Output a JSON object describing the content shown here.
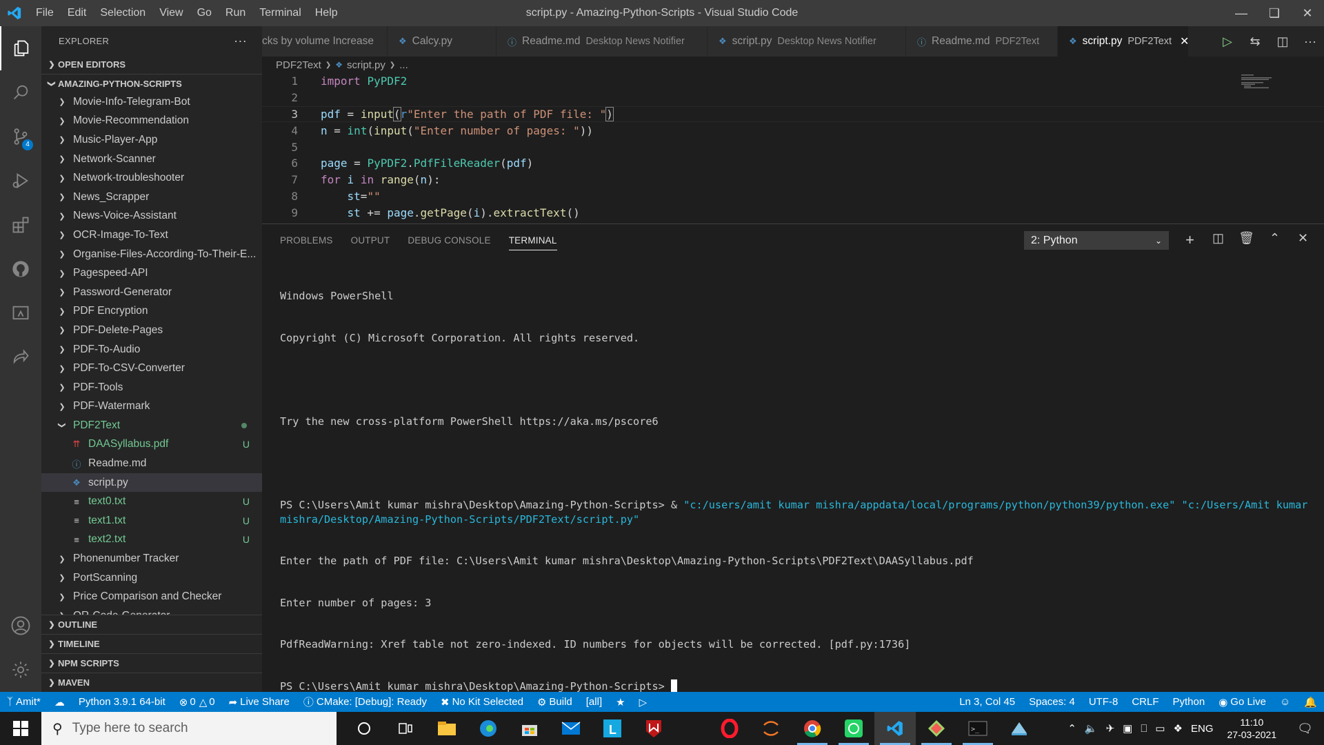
{
  "window": {
    "title": "script.py - Amazing-Python-Scripts - Visual Studio Code",
    "menu": [
      "File",
      "Edit",
      "Selection",
      "View",
      "Go",
      "Run",
      "Terminal",
      "Help"
    ]
  },
  "activity_bar": {
    "items": [
      "explorer-icon",
      "search-icon",
      "source-control-icon",
      "run-debug-icon",
      "extensions-icon",
      "github-icon",
      "remote-explorer-icon",
      "live-share-icon"
    ],
    "source_control_badge": "4",
    "bottom": [
      "account-icon",
      "settings-gear-icon"
    ]
  },
  "sidebar": {
    "title": "EXPLORER",
    "open_editors": "OPEN EDITORS",
    "workspace": "AMAZING-PYTHON-SCRIPTS",
    "folders": [
      "Movie-Info-Telegram-Bot",
      "Movie-Recommendation",
      "Music-Player-App",
      "Network-Scanner",
      "Network-troubleshooter",
      "News_Scrapper",
      "News-Voice-Assistant",
      "OCR-Image-To-Text",
      "Organise-Files-According-To-Their-E...",
      "Pagespeed-API",
      "Password-Generator",
      "PDF Encryption",
      "PDF-Delete-Pages",
      "PDF-To-Audio",
      "PDF-To-CSV-Converter",
      "PDF-Tools",
      "PDF-Watermark"
    ],
    "open_folder": "PDF2Text",
    "files": [
      {
        "name": "DAASyllabus.pdf",
        "status": "U"
      },
      {
        "name": "Readme.md",
        "status": ""
      },
      {
        "name": "script.py",
        "status": ""
      },
      {
        "name": "text0.txt",
        "status": "U"
      },
      {
        "name": "text1.txt",
        "status": "U"
      },
      {
        "name": "text2.txt",
        "status": "U"
      }
    ],
    "folders_after": [
      "Phonenumber Tracker",
      "PortScanning",
      "Price Comparison and Checker",
      "QR-Code-Generator"
    ],
    "sections": [
      "OUTLINE",
      "TIMELINE",
      "NPM SCRIPTS",
      "MAVEN"
    ]
  },
  "tabs": [
    {
      "name": "cks by volume Increase",
      "desc": ""
    },
    {
      "name": "Calcy.py",
      "desc": ""
    },
    {
      "name": "Readme.md",
      "desc": "Desktop News Notifier"
    },
    {
      "name": "script.py",
      "desc": "Desktop News Notifier"
    },
    {
      "name": "Readme.md",
      "desc": "PDF2Text"
    },
    {
      "name": "script.py",
      "desc": "PDF2Text"
    }
  ],
  "breadcrumb": [
    "PDF2Text",
    "script.py",
    "..."
  ],
  "editor": {
    "line_numbers": [
      "1",
      "2",
      "3",
      "4",
      "5",
      "6",
      "7",
      "8",
      "9"
    ],
    "lines": [
      "import PyPDF2",
      "",
      "pdf = input(r\"Enter the path of PDF file: \")",
      "n = int(input(\"Enter number of pages: \"))",
      "",
      "page = PyPDF2.PdfFileReader(pdf)",
      "for i in range(n):",
      "    st=\"\"",
      "    st += page.getPage(i).extractText()"
    ]
  },
  "panel": {
    "tabs": [
      "PROBLEMS",
      "OUTPUT",
      "DEBUG CONSOLE",
      "TERMINAL"
    ],
    "terminal_select": "2: Python",
    "terminal_lines": [
      "Windows PowerShell",
      "Copyright (C) Microsoft Corporation. All rights reserved.",
      "",
      "Try the new cross-platform PowerShell https://aka.ms/pscore6",
      ""
    ],
    "prompt": "PS C:\\Users\\Amit kumar mishra\\Desktop\\Amazing-Python-Scripts> & ",
    "command": "\"c:/users/amit kumar mishra/appdata/local/programs/python/python39/python.exe\" \"c:/Users/Amit kumar mishra/Desktop/Amazing-Python-Scripts/PDF2Text/script.py\"",
    "output_lines": [
      "Enter the path of PDF file: C:\\Users\\Amit kumar mishra\\Desktop\\Amazing-Python-Scripts\\PDF2Text\\DAASyllabus.pdf",
      "Enter number of pages: 3",
      "PdfReadWarning: Xref table not zero-indexed. ID numbers for objects will be corrected. [pdf.py:1736]"
    ],
    "final_prompt": "PS C:\\Users\\Amit kumar mishra\\Desktop\\Amazing-Python-Scripts> "
  },
  "statusbar": {
    "left": [
      "Amit*",
      "Python 3.9.1 64-bit",
      "0",
      "0",
      "Live Share",
      "CMake: [Debug]: Ready",
      "No Kit Selected",
      "Build",
      "[all]"
    ],
    "right": [
      "Ln 3, Col 45",
      "Spaces: 4",
      "UTF-8",
      "CRLF",
      "Python",
      "Go Live"
    ]
  },
  "taskbar": {
    "search_placeholder": "Type here to search",
    "lang": "ENG",
    "time": "11:10",
    "date": "27-03-2021"
  },
  "colors": {
    "accent": "#007acc",
    "untracked": "#73c991",
    "terminal_link": "#29b8db"
  }
}
